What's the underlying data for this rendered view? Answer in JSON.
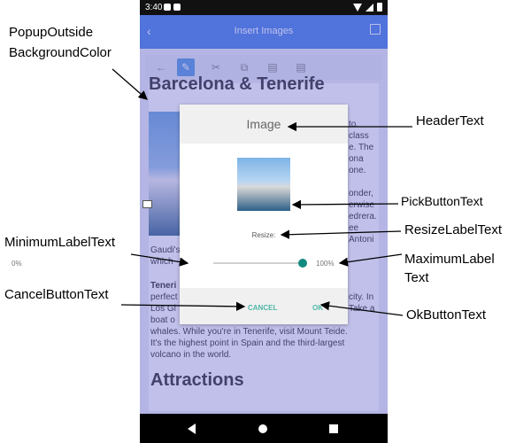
{
  "status": {
    "time": "3:40"
  },
  "app": {
    "title": "Insert Images"
  },
  "document": {
    "title": "Barcelona & Tenerife",
    "right_fragments": [
      "to.",
      "class",
      "e. The",
      "ona",
      "one.",
      "onder,",
      "erwise",
      "edrera.",
      "ee",
      "Antoni"
    ],
    "left_fragments": [
      "Gaudi's",
      "which"
    ],
    "para_tenerife": [
      "Teneri",
      "perfect",
      "Los Gi",
      "boat o"
    ],
    "para_tenerife_right": [
      "city. In",
      "Take a"
    ],
    "para_tail": [
      "whales. While you're in Tenerife, visit Mount Teide.",
      "It's the highest point in Spain and the third-largest",
      "volcano in the world."
    ],
    "section": "Attractions"
  },
  "dialog": {
    "header": "Image",
    "resize_label": "Resize:",
    "min_label": "0%",
    "max_label": "100%",
    "slider_value_percent": 100,
    "cancel": "CANCEL",
    "ok": "OK"
  },
  "annotations": {
    "popup_outside_1": "PopupOutside",
    "popup_outside_2": "BackgroundColor",
    "header_text": "HeaderText",
    "pick_button_text": "PickButtonText",
    "minimum_label_text": "MinimumLabelText",
    "resize_label_text": "ResizeLabelText",
    "maximum_label_1": "MaximumLabel",
    "maximum_label_2": "Text",
    "cancel_button_text": "CancelButtonText",
    "ok_button_text": "OkButtonText"
  },
  "colors": {
    "app_bar": "#4b84e8",
    "overlay": "rgba(90,90,200,0.38)",
    "accent": "#138a7e",
    "button_text": "#4fb7a8"
  }
}
